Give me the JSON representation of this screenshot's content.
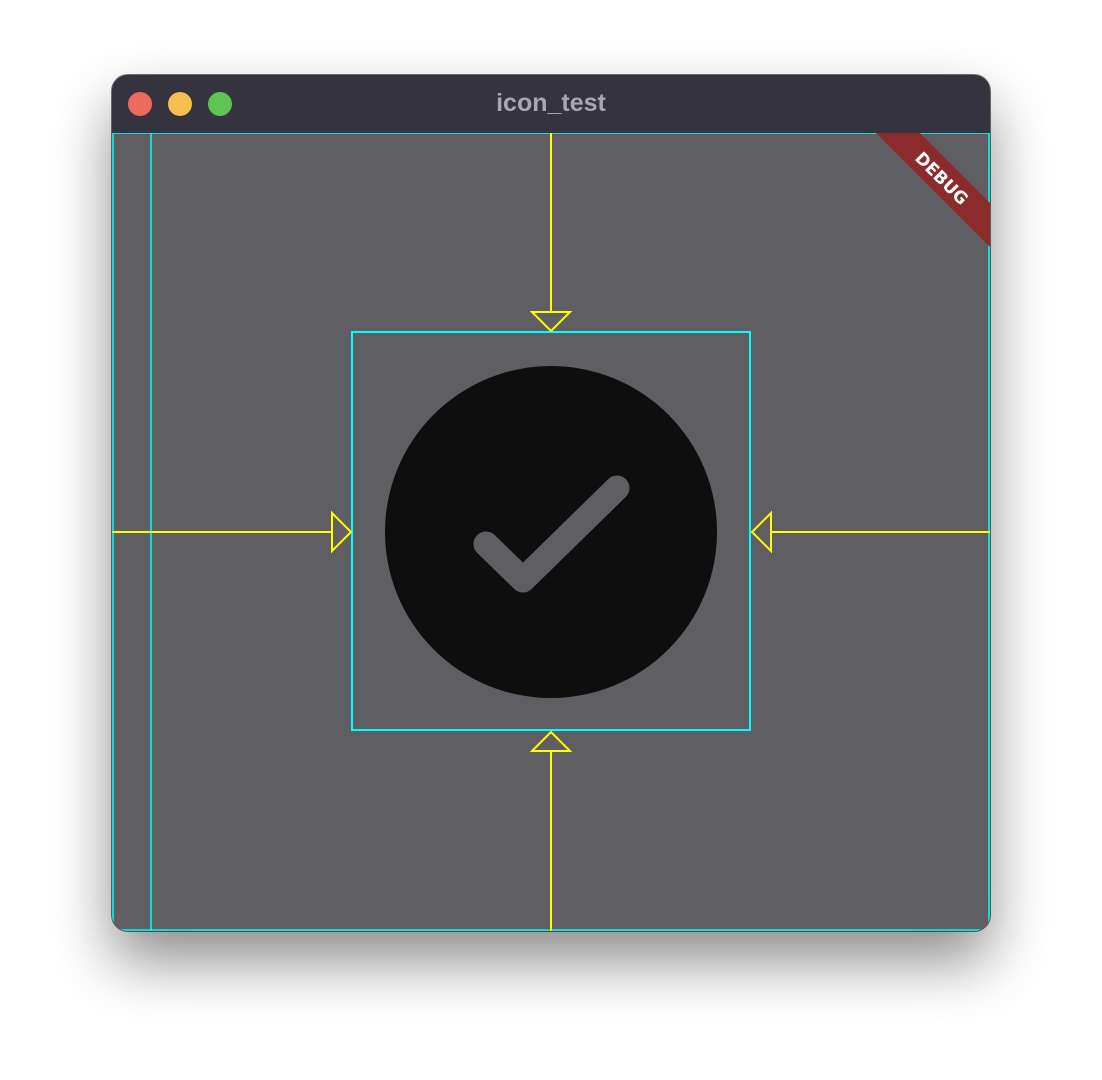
{
  "window": {
    "title": "icon_test",
    "controls": {
      "close_color": "#ec6a5e",
      "minimize_color": "#f4bf4f",
      "maximize_color": "#61c554"
    }
  },
  "debug_banner": {
    "label": "DEBUG",
    "color": "#8b2b2b"
  },
  "icon": {
    "name": "check-circle-icon",
    "circle_color": "#0e0e0e",
    "check_color": "#5f5f63"
  },
  "debug_overlay": {
    "layout_outline_color": "#00ffff",
    "arrow_color": "#ffff00"
  },
  "colors": {
    "titlebar": "#35333e",
    "content_background": "#5f5f63"
  }
}
